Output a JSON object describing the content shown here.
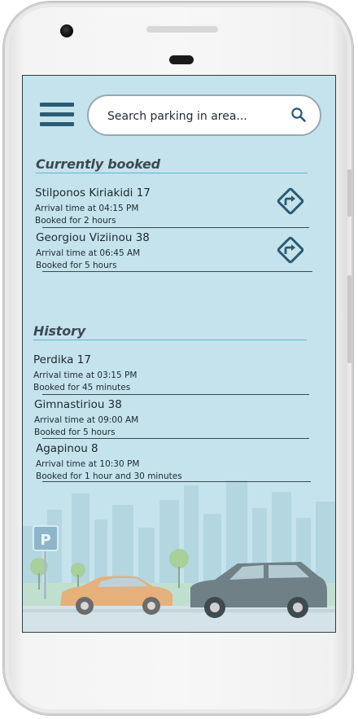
{
  "search": {
    "placeholder": "Search parking in area..."
  },
  "current": {
    "title": "Currently booked",
    "items": [
      {
        "street": "Stilponos Kiriakidi 17",
        "arrival": "Arrival time at 04:15 PM",
        "booked": "Booked for 2 hours"
      },
      {
        "street": "Georgiou Viziinou 38",
        "arrival": "Arrival time at 06:45 AM",
        "booked": "Booked for 5 hours"
      }
    ]
  },
  "history": {
    "title": "History",
    "items": [
      {
        "street": "Perdika 17",
        "arrival": "Arrival time at  03:15 PM",
        "booked": "Booked for 45 minutes"
      },
      {
        "street": "Gimnastiriou 38",
        "arrival": "Arrival time at  09:00 AM",
        "booked": "Booked for 5 hours"
      },
      {
        "street": "Agapinou 8",
        "arrival": "Arrival time at 10:30 PM",
        "booked": "Booked for 1 hour and 30 minutes"
      }
    ]
  },
  "parking_sign": "P",
  "colors": {
    "screen_bg": "#c5e3ec",
    "accent": "#2b5b72",
    "title_underline": "#5fb5d8"
  }
}
